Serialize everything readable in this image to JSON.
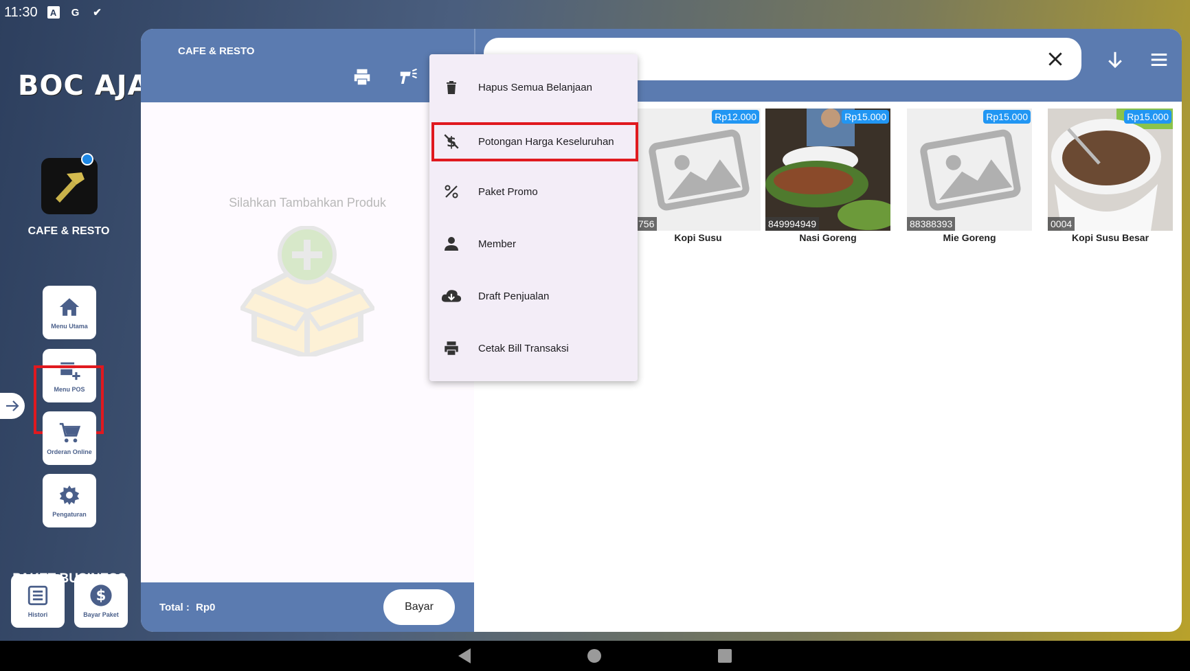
{
  "status_bar": {
    "time": "11:30",
    "icons": [
      "a-icon",
      "google-icon",
      "check-icon"
    ]
  },
  "sidebar": {
    "logo_text": "BOC AJA",
    "store_name": "CAFE & RESTO",
    "items": [
      {
        "label": "Menu Utama",
        "icon": "home-icon"
      },
      {
        "label": "Menu POS",
        "icon": "store-add-icon"
      },
      {
        "label": "Orderan Online",
        "icon": "cart-icon"
      },
      {
        "label": "Pengaturan",
        "icon": "gear-icon"
      }
    ],
    "package_label": "PAKET BUSINESS",
    "bottom_items": [
      {
        "label": "Histori",
        "icon": "list-icon"
      },
      {
        "label": "Bayar Paket",
        "icon": "dollar-icon"
      }
    ]
  },
  "cart": {
    "title": "CAFE & RESTO",
    "empty_text": "Silahkan Tambahkan Produk",
    "total_label": "Total :",
    "total_value": "Rp0",
    "pay_label": "Bayar"
  },
  "dropdown": {
    "items": [
      {
        "label": "Hapus Semua Belanjaan",
        "icon": "trash-icon"
      },
      {
        "label": "Potongan Harga Keseluruhan",
        "icon": "money-off-icon"
      },
      {
        "label": "Paket Promo",
        "icon": "percent-icon"
      },
      {
        "label": "Member",
        "icon": "person-icon"
      },
      {
        "label": "Draft Penjualan",
        "icon": "cloud-download-icon"
      },
      {
        "label": "Cetak Bill Transaksi",
        "icon": "printer-icon"
      }
    ]
  },
  "products": [
    {
      "name": "Kopi Susu",
      "price": "Rp12.000",
      "code": "756"
    },
    {
      "name": "Nasi Goreng",
      "price": "Rp15.000",
      "code": "849994949"
    },
    {
      "name": "Mie Goreng",
      "price": "Rp15.000",
      "code": "88388393"
    },
    {
      "name": "Kopi Susu Besar",
      "price": "Rp15.000",
      "code": "0004"
    }
  ],
  "colors": {
    "accent": "#5b7bb0",
    "highlight": "#e0191f",
    "price_badge": "#2196f3"
  }
}
